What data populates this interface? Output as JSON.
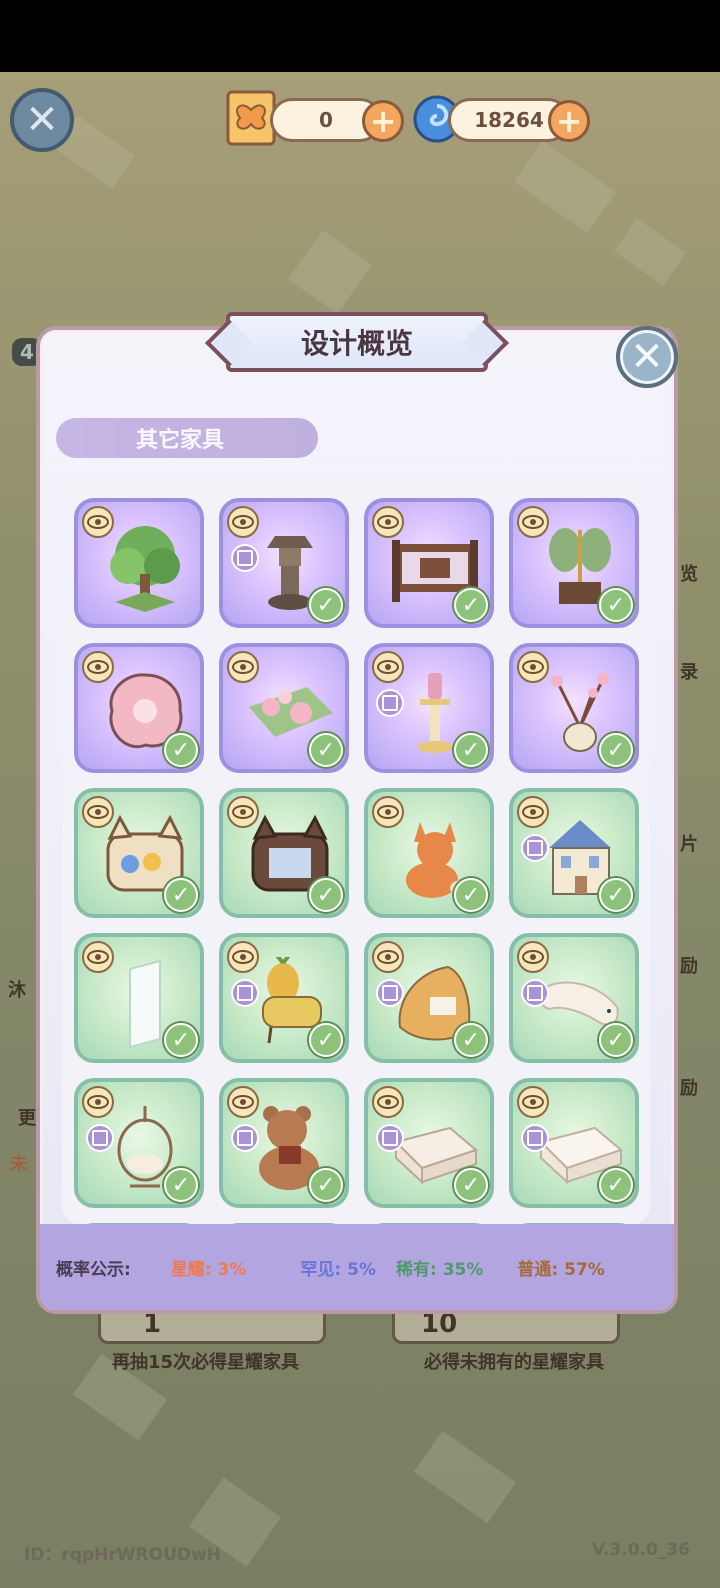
{
  "currencies": [
    {
      "name": "butterfly-ticket",
      "value": "0"
    },
    {
      "name": "swirl-gem",
      "value": "18264"
    }
  ],
  "panel": {
    "title": "设计概览",
    "section": "其它家具"
  },
  "items": [
    {
      "name": "tree",
      "frame": "purple",
      "owned": false,
      "has_box": false
    },
    {
      "name": "stone-lantern",
      "frame": "purple",
      "owned": true,
      "has_box": true
    },
    {
      "name": "carved-screen-fence",
      "frame": "purple",
      "owned": true,
      "has_box": false
    },
    {
      "name": "bamboo-fan-stand",
      "frame": "purple",
      "owned": true,
      "has_box": false
    },
    {
      "name": "sakura-rug",
      "frame": "purple",
      "owned": true,
      "has_box": false
    },
    {
      "name": "flower-mat",
      "frame": "purple",
      "owned": true,
      "has_box": false
    },
    {
      "name": "candle-holder",
      "frame": "purple",
      "owned": true,
      "has_box": true
    },
    {
      "name": "blossom-vase",
      "frame": "purple",
      "owned": true,
      "has_box": false
    },
    {
      "name": "cat-bag-light",
      "frame": "green",
      "owned": true,
      "has_box": false
    },
    {
      "name": "cat-bag-dark",
      "frame": "green",
      "owned": true,
      "has_box": false
    },
    {
      "name": "fox-plush",
      "frame": "green",
      "owned": true,
      "has_box": false
    },
    {
      "name": "dollhouse",
      "frame": "green",
      "owned": true,
      "has_box": true
    },
    {
      "name": "glass-panel",
      "frame": "green",
      "owned": true,
      "has_box": false
    },
    {
      "name": "pineapple-chair",
      "frame": "green",
      "owned": true,
      "has_box": true
    },
    {
      "name": "beanbag",
      "frame": "green",
      "owned": true,
      "has_box": true
    },
    {
      "name": "seal-pillow",
      "frame": "green",
      "owned": true,
      "has_box": true
    },
    {
      "name": "hanging-chair",
      "frame": "green",
      "owned": true,
      "has_box": true
    },
    {
      "name": "teddy-bear",
      "frame": "green",
      "owned": true,
      "has_box": true
    },
    {
      "name": "bathtub-a",
      "frame": "green",
      "owned": true,
      "has_box": true
    },
    {
      "name": "bathtub-b",
      "frame": "green",
      "owned": true,
      "has_box": true
    }
  ],
  "odds": {
    "label": "概率公示:",
    "star": "星耀: 3%",
    "rare_seen": "罕见: 5%",
    "rare": "稀有: 35%",
    "common": "普通: 57%",
    "colors": {
      "star": "#ee7a52",
      "rare_seen": "#6a74d6",
      "rare": "#4f9a6a",
      "common": "#a66a3a"
    }
  },
  "background": {
    "left_labels": [
      "沐",
      "更",
      "未"
    ],
    "right_labels": [
      "览",
      "录",
      "片",
      "励",
      "励"
    ],
    "pull_one_text": "再抽15次必得星耀家具",
    "pull_ten_text": "必得未拥有的星耀家具",
    "pull_one_num": "1",
    "pull_ten_num": "10",
    "left_badge": "4"
  },
  "footer": {
    "id": "ID：rqpHrWROUDwH",
    "version": "V.3.0.0_36"
  }
}
